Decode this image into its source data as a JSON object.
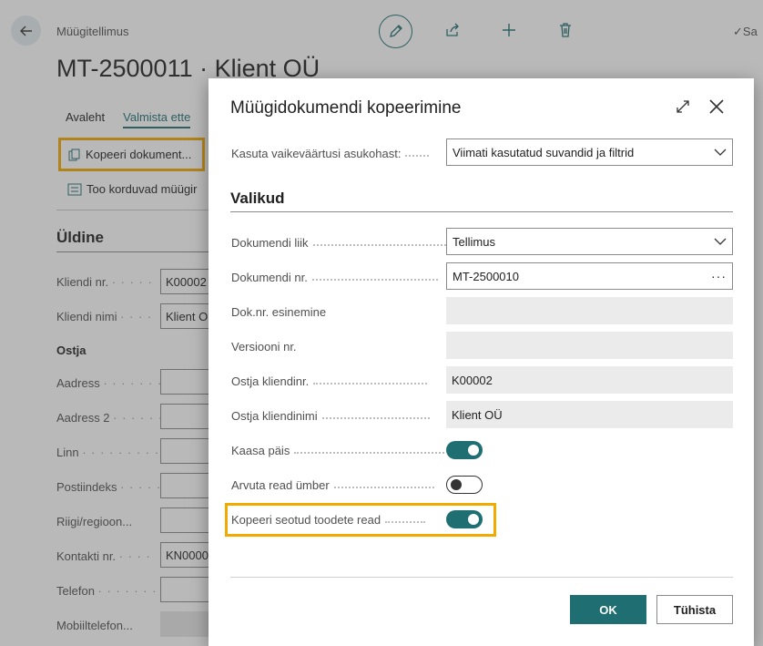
{
  "background": {
    "caption": "Müügitellimus",
    "title": "MT-2500011 · Klient OÜ",
    "saved_label": "Sa",
    "tabs": [
      "Avaleht",
      "Valmista ette"
    ],
    "actions": {
      "copy_document": "Kopeeri dokument...",
      "get_recurring": "Too korduvad müügir"
    },
    "section_title": "Üldine",
    "fields": {
      "customer_no_label": "Kliendi nr.",
      "customer_no_value": "K00002",
      "customer_name_label": "Kliendi nimi",
      "customer_name_value": "Klient O",
      "buyer_subhead": "Ostja",
      "address_label": "Aadress",
      "address2_label": "Aadress 2",
      "city_label": "Linn",
      "postcode_label": "Postiindeks",
      "country_label": "Riigi/regioon...",
      "contact_no_label": "Kontakti nr.",
      "contact_no_value": "KN0000",
      "phone_label": "Telefon",
      "mobile_label": "Mobiiltelefon..."
    }
  },
  "dialog": {
    "title": "Müügidokumendi kopeerimine",
    "defaults_label": "Kasuta vaikeväärtusi asukohast:",
    "defaults_value": "Viimati kasutatud suvandid ja filtrid",
    "section": "Valikud",
    "fields": {
      "doc_type_label": "Dokumendi liik",
      "doc_type_value": "Tellimus",
      "doc_no_label": "Dokumendi nr.",
      "doc_no_value": "MT-2500010",
      "doc_occurrence_label": "Dok.nr. esinemine",
      "doc_occurrence_value": "",
      "version_label": "Versiooni nr.",
      "version_value": "",
      "buyer_no_label": "Ostja kliendinr.",
      "buyer_no_value": "K00002",
      "buyer_name_label": "Ostja kliendinimi",
      "buyer_name_value": "Klient OÜ",
      "include_header_label": "Kaasa päis",
      "include_header_on": true,
      "recalc_lines_label": "Arvuta read ümber",
      "recalc_lines_on": false,
      "copy_linked_label": "Kopeeri seotud toodete read",
      "copy_linked_on": true
    },
    "ok_label": "OK",
    "cancel_label": "Tühista"
  },
  "colors": {
    "accent": "#1f6f72",
    "highlight": "#f2a900"
  }
}
